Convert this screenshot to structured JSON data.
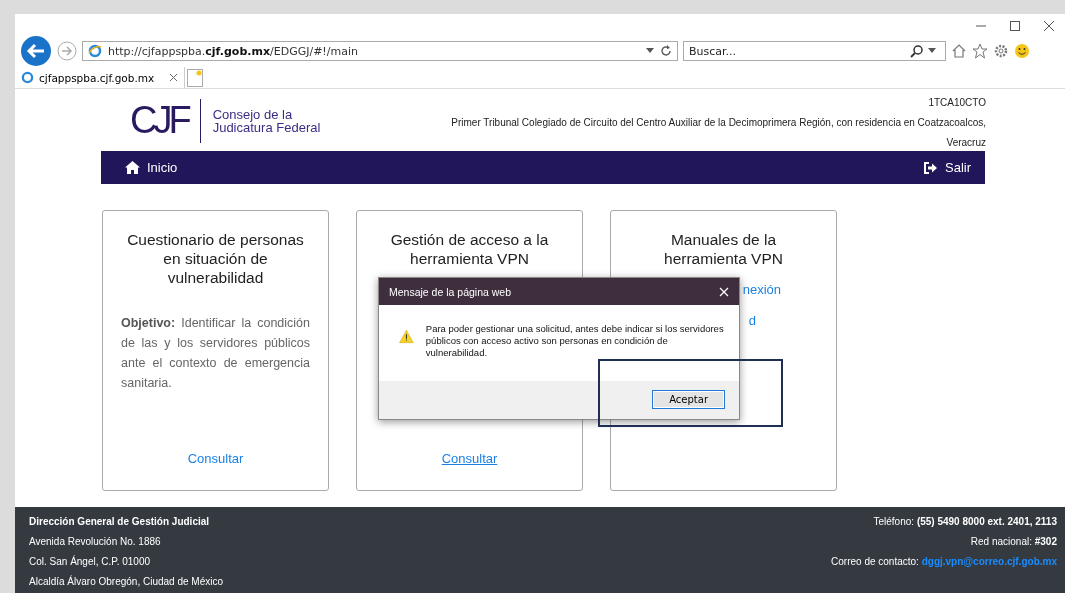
{
  "browser": {
    "url_prefix": "http://cjfappspba.",
    "url_domain": "cjf.gob.mx",
    "url_path": "/EDGGJ/#!/main",
    "search_placeholder": "Buscar...",
    "tab_title": "cjfappspba.cjf.gob.mx"
  },
  "header": {
    "logo_mark": "CJF",
    "logo_line1": "Consejo de la",
    "logo_line2": "Judicatura Federal",
    "code": "1TCA10CTO",
    "court": "Primer Tribunal Colegiado de Circuito del Centro Auxiliar de la Decimoprimera Región, con residencia en Coatzacoalcos,",
    "court_line2": "Veracruz"
  },
  "nav": {
    "home": "Inicio",
    "logout": "Salir"
  },
  "cards": [
    {
      "title": "Cuestionario de personas en situación de vulnerabilidad",
      "objective_label": "Objetivo:",
      "objective": "Identificar la condición de las y los servidores públicos ante el contexto de emergencia sanitaria.",
      "links": [
        {
          "text": "Consultar",
          "underlined": false
        }
      ]
    },
    {
      "title": "Gestión de acceso a la herramienta VPN",
      "links": [
        {
          "text": "Consultar",
          "underlined": true
        }
      ]
    },
    {
      "title": "Manuales de la herramienta VPN",
      "partial_links": [
        "nexión",
        "d"
      ]
    }
  ],
  "dialog": {
    "title": "Mensaje de la página web",
    "message": "Para poder gestionar una solicitud, antes debe indicar si los servidores públicos con acceso activo son personas en condición de vulnerabilidad.",
    "button": "Aceptar"
  },
  "footer": {
    "left": [
      "Dirección General de Gestión Judicial",
      "Avenida Revolución No. 1886",
      "Col. San Ángel, C.P. 01000",
      "Alcaldía Álvaro Obregón, Ciudad de México"
    ],
    "phone_label": "Teléfono:",
    "phone": "(55) 5490 8000 ext. 2401, 2113",
    "net_label": "Red nacional:",
    "net": "#302",
    "mail_label": "Correo de contacto:",
    "mail": "dggj.vpn@correo.cjf.gob.mx"
  }
}
